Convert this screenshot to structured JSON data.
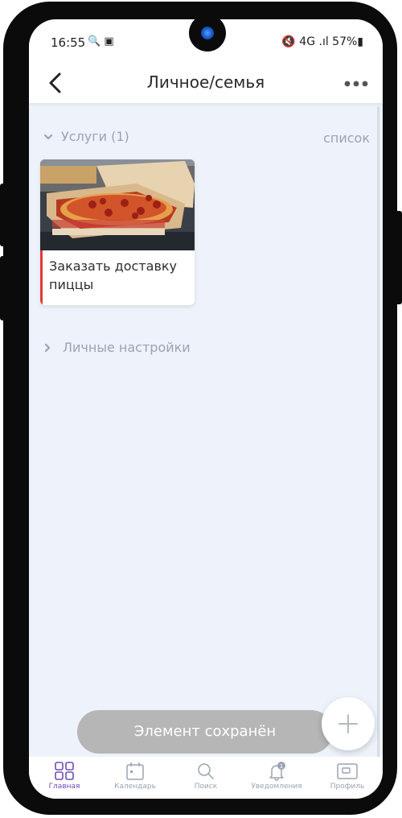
{
  "status_bar": {
    "time": "16:55",
    "left_icons": "🔍 ▣",
    "right": "🔇 4G .ıl 57%▮"
  },
  "header": {
    "title": "Личное/семья"
  },
  "services_section": {
    "title": "Услуги (1)",
    "view_link": "список"
  },
  "cards": [
    {
      "label": "Заказать доставку пиццы",
      "image": "pizza-photo",
      "accent_color": "#e33a3a"
    }
  ],
  "personal_section": {
    "title": "Личные настройки"
  },
  "toast": {
    "text": "Элемент сохранён"
  },
  "fab": {
    "icon": "plus-icon"
  },
  "tabs": [
    {
      "label": "Главная",
      "icon": "grid-icon",
      "active": true
    },
    {
      "label": "Календарь",
      "icon": "calendar-icon",
      "active": false
    },
    {
      "label": "Поиск",
      "icon": "search-icon",
      "active": false
    },
    {
      "label": "Уведомления",
      "icon": "bell-icon",
      "active": false,
      "badge": "1"
    },
    {
      "label": "Профиль",
      "icon": "profile-card-icon",
      "active": false
    }
  ],
  "colors": {
    "accent_purple": "#6e4bb8",
    "card_accent": "#e33a3a",
    "background": "#eef3fb"
  }
}
